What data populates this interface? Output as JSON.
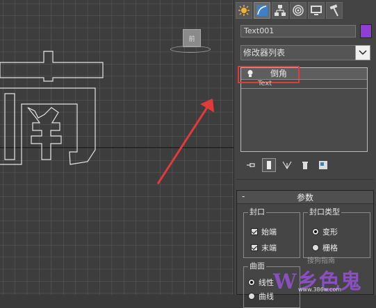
{
  "viewport": {
    "view_label": "前",
    "viewcube_icon": "viewcube-icon"
  },
  "panel": {
    "tabs": [
      {
        "name": "create-tab",
        "icon": "sun-icon"
      },
      {
        "name": "modify-tab",
        "icon": "modify-curve-icon",
        "active": true
      },
      {
        "name": "hierarchy-tab",
        "icon": "hierarchy-icon"
      },
      {
        "name": "motion-tab",
        "icon": "motion-icon"
      },
      {
        "name": "display-tab",
        "icon": "display-icon"
      },
      {
        "name": "utilities-tab",
        "icon": "hammer-icon"
      }
    ],
    "object_name": "Text001",
    "object_color": "#8f3fd6",
    "modifier_list_label": "修改器列表",
    "stack_items": [
      {
        "label": "倒角",
        "selected": true
      },
      {
        "label": "Text",
        "selected": false
      }
    ],
    "stack_tools": [
      "pin-stack-icon",
      "show-end-result-icon",
      "make-unique-icon",
      "remove-modifier-icon",
      "configure-sets-icon"
    ]
  },
  "rollout": {
    "collapse_symbol": "-",
    "title": "参数",
    "capping": {
      "title": "封口",
      "start_label": "始端",
      "start_checked": true,
      "end_label": "末端",
      "end_checked": true
    },
    "cap_type": {
      "title": "封口类型",
      "morph_label": "变形",
      "morph_selected": true,
      "grid_label": "栅格",
      "grid_selected": false
    },
    "surface": {
      "title": "曲面",
      "linear_label": "线性",
      "curved_label": "曲线"
    }
  },
  "watermark": {
    "text": "W乡色鬼",
    "url": "www.386w.com",
    "secondary": "搜狗指南"
  },
  "colors": {
    "highlight": "#e23a3a",
    "arrow": "#e23a3a"
  }
}
